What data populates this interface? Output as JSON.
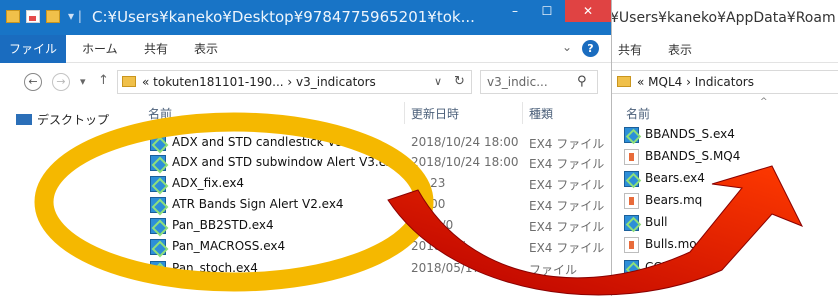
{
  "left_window": {
    "title": "C:¥Users¥kaneko¥Desktop¥9784775965201¥tok...",
    "ribbon_tabs": [
      "ファイル",
      "ホーム",
      "共有",
      "表示"
    ],
    "address": "« tokuten181101-190...  ›  v3_indicators",
    "search_placeholder": "v3_indic...",
    "nav_item": "デスクトップ",
    "columns": {
      "name": "名前",
      "date": "更新日時",
      "type": "種類"
    },
    "files": [
      {
        "name": "ADX and STD candlestick V3.ex4",
        "date": "2018/10/24 18:00",
        "type": "EX4 ファイル"
      },
      {
        "name": "ADX and STD subwindow Alert V3.ex4",
        "date": "2018/10/24 18:00",
        "type": "EX4 ファイル"
      },
      {
        "name": "ADX_fix.ex4",
        "date": "20        23",
        "type": "EX4 ファイル"
      },
      {
        "name": "ATR Bands Sign Alert V2.ex4",
        "date": "20        00",
        "type": "EX4 ファイル"
      },
      {
        "name": "Pan_BB2STD.ex4",
        "date": "2018/0",
        "type": "EX4 ファイル"
      },
      {
        "name": "Pan_MACROSS.ex4",
        "date": "2018/05/",
        "type": "EX4 ファイル"
      },
      {
        "name": "Pan_stoch.ex4",
        "date": "2018/05/17 1",
        "type": "ファイル"
      }
    ]
  },
  "right_window": {
    "title": "¥Users¥kaneko¥AppData¥Roam",
    "ribbon_tabs": [
      "共有",
      "表示"
    ],
    "address": "« MQL4  ›  Indicators",
    "column_name": "名前",
    "files": [
      {
        "name": "BBANDS_S.ex4",
        "icon": "ex4"
      },
      {
        "name": "BBANDS_S.MQ4",
        "icon": "mq4"
      },
      {
        "name": "Bears.ex4",
        "icon": "ex4"
      },
      {
        "name": "Bears.mq",
        "icon": "mq4"
      },
      {
        "name": "Bull",
        "icon": "ex4"
      },
      {
        "name": "Bulls.mo",
        "icon": "mq4"
      },
      {
        "name": "CCI",
        "icon": "ex4"
      }
    ]
  },
  "annotation": {
    "ellipse_color": "#f5b800",
    "arrow_color_start": "#b80000",
    "arrow_color_end": "#ff3a00"
  }
}
